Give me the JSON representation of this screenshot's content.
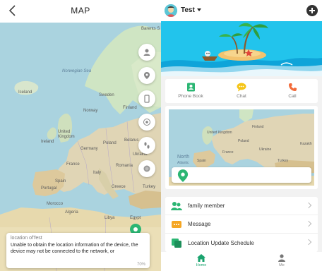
{
  "left": {
    "title": "MAP",
    "map_labels": {
      "barents": "Barents S",
      "norwegian": "Norwegian Sea",
      "iceland": "Iceland",
      "sweden": "Sweden",
      "finland": "Finland",
      "norway": "Norway",
      "uk": "United Kingdom",
      "ireland": "Ireland",
      "germany": "Germany",
      "poland": "Poland",
      "belarus": "Belarus",
      "ukraine": "Ukraine",
      "france": "France",
      "romania": "Romania",
      "italy": "Italy",
      "spain": "Spain",
      "portugal": "Portugal",
      "greece": "Greece",
      "turkey": "Turkey",
      "morocco": "Morocco",
      "algeria": "Algeria",
      "libya": "Libya",
      "egypt": "Egypt"
    },
    "notice": {
      "title": "location ofTest",
      "body": "Unable to obtain the location information of the device, the device may not be connected to the network, or",
      "zoom": "70%"
    },
    "map_controls": [
      "person-icon",
      "location-icon",
      "device-icon",
      "satellite-icon",
      "foot-icon",
      "layer-icon"
    ]
  },
  "right": {
    "device_name": "Test",
    "quick_actions": [
      {
        "label": "Phone Book",
        "icon": "phonebook-icon",
        "color": "#2bb673"
      },
      {
        "label": "Chat",
        "icon": "chat-icon",
        "color": "#f5c518"
      },
      {
        "label": "Call",
        "icon": "call-icon",
        "color": "#f26b3a"
      }
    ],
    "mini_map_labels": {
      "uk": "United Kingdom",
      "finland": "Finland",
      "poland": "Poland",
      "kazakh": "Kazakh",
      "ukraine": "Ukraine",
      "france": "France",
      "turkey": "Turkey",
      "north": "North",
      "atlantic": "Atlantic",
      "spain": "Spain"
    },
    "menu": [
      {
        "label": "family member",
        "icon": "family-icon",
        "color": "#2bb673"
      },
      {
        "label": "Message",
        "icon": "message-icon",
        "color": "#f5a623"
      },
      {
        "label": "Location Update Schedule",
        "icon": "schedule-icon",
        "color": "#2bb673"
      }
    ],
    "tabs": [
      {
        "label": "Home",
        "active": true
      },
      {
        "label": "Me",
        "active": false
      }
    ],
    "colors": {
      "accent": "#1aa36e",
      "banner": "#1fc2eb"
    }
  }
}
